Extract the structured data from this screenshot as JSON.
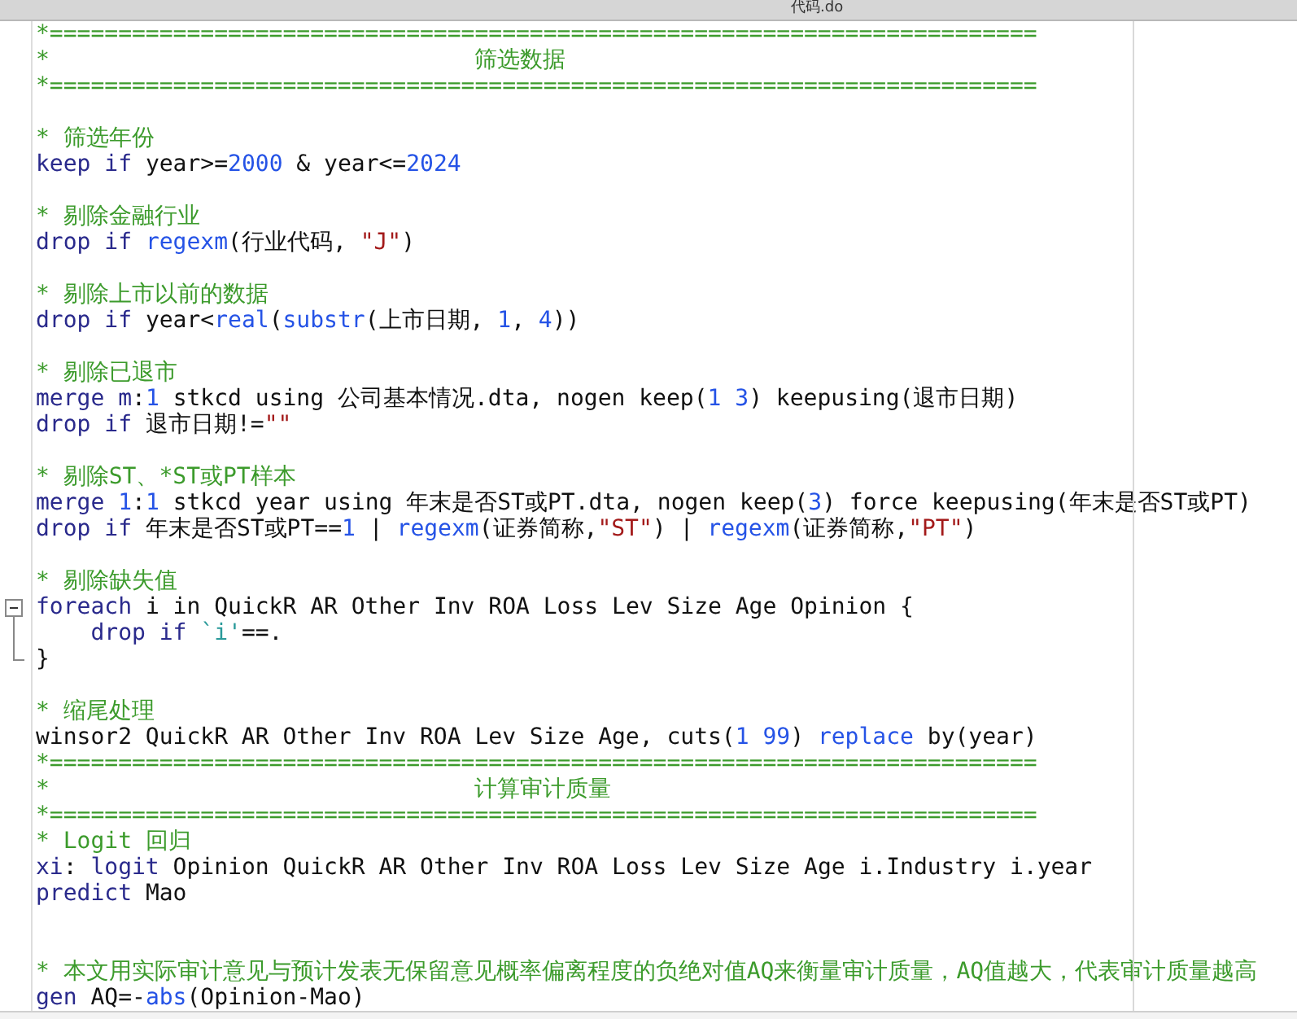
{
  "window": {
    "title": "代码.do"
  },
  "editor": {
    "lines": [
      {
        "kind": "code",
        "tokens": [
          {
            "kind": "comment",
            "text": "*========================================================================"
          }
        ]
      },
      {
        "kind": "code",
        "tokens": [
          {
            "kind": "comment",
            "text": "*                               筛选数据"
          }
        ]
      },
      {
        "kind": "code",
        "tokens": [
          {
            "kind": "comment",
            "text": "*========================================================================"
          }
        ]
      },
      {
        "kind": "blank"
      },
      {
        "kind": "code",
        "tokens": [
          {
            "kind": "comment",
            "text": "* 筛选年份"
          }
        ]
      },
      {
        "kind": "code",
        "tokens": [
          {
            "kind": "keyword",
            "text": "keep if"
          },
          {
            "kind": "plain",
            "text": " year>="
          },
          {
            "kind": "number",
            "text": "2000"
          },
          {
            "kind": "plain",
            "text": " & year<="
          },
          {
            "kind": "number",
            "text": "2024"
          }
        ]
      },
      {
        "kind": "blank"
      },
      {
        "kind": "code",
        "tokens": [
          {
            "kind": "comment",
            "text": "* 剔除金融行业"
          }
        ]
      },
      {
        "kind": "code",
        "tokens": [
          {
            "kind": "keyword",
            "text": "drop if "
          },
          {
            "kind": "function",
            "text": "regexm"
          },
          {
            "kind": "plain",
            "text": "(行业代码, "
          },
          {
            "kind": "string",
            "text": "\"J\""
          },
          {
            "kind": "plain",
            "text": ")"
          }
        ]
      },
      {
        "kind": "blank"
      },
      {
        "kind": "code",
        "tokens": [
          {
            "kind": "comment",
            "text": "* 剔除上市以前的数据"
          }
        ]
      },
      {
        "kind": "code",
        "tokens": [
          {
            "kind": "keyword",
            "text": "drop if"
          },
          {
            "kind": "plain",
            "text": " year<"
          },
          {
            "kind": "function",
            "text": "real"
          },
          {
            "kind": "plain",
            "text": "("
          },
          {
            "kind": "function",
            "text": "substr"
          },
          {
            "kind": "plain",
            "text": "(上市日期, "
          },
          {
            "kind": "number",
            "text": "1"
          },
          {
            "kind": "plain",
            "text": ", "
          },
          {
            "kind": "number",
            "text": "4"
          },
          {
            "kind": "plain",
            "text": "))"
          }
        ]
      },
      {
        "kind": "blank"
      },
      {
        "kind": "code",
        "tokens": [
          {
            "kind": "comment",
            "text": "* 剔除已退市"
          }
        ]
      },
      {
        "kind": "code",
        "tokens": [
          {
            "kind": "keyword",
            "text": "merge m"
          },
          {
            "kind": "plain",
            "text": ":"
          },
          {
            "kind": "number",
            "text": "1"
          },
          {
            "kind": "plain",
            "text": " stkcd using 公司基本情况.dta, nogen keep("
          },
          {
            "kind": "number",
            "text": "1 3"
          },
          {
            "kind": "plain",
            "text": ") keepusing(退市日期)"
          }
        ]
      },
      {
        "kind": "code",
        "tokens": [
          {
            "kind": "keyword",
            "text": "drop if"
          },
          {
            "kind": "plain",
            "text": " 退市日期!="
          },
          {
            "kind": "string",
            "text": "\"\""
          }
        ]
      },
      {
        "kind": "blank"
      },
      {
        "kind": "code",
        "tokens": [
          {
            "kind": "comment",
            "text": "* 剔除ST、*ST或PT样本"
          }
        ]
      },
      {
        "kind": "code",
        "tokens": [
          {
            "kind": "keyword",
            "text": "merge "
          },
          {
            "kind": "number",
            "text": "1"
          },
          {
            "kind": "plain",
            "text": ":"
          },
          {
            "kind": "number",
            "text": "1"
          },
          {
            "kind": "plain",
            "text": " stkcd year using 年末是否ST或PT.dta, nogen keep("
          },
          {
            "kind": "number",
            "text": "3"
          },
          {
            "kind": "plain",
            "text": ") force keepusing(年末是否ST或PT)"
          }
        ]
      },
      {
        "kind": "code",
        "tokens": [
          {
            "kind": "keyword",
            "text": "drop if"
          },
          {
            "kind": "plain",
            "text": " 年末是否ST或PT=="
          },
          {
            "kind": "number",
            "text": "1"
          },
          {
            "kind": "plain",
            "text": " | "
          },
          {
            "kind": "function",
            "text": "regexm"
          },
          {
            "kind": "plain",
            "text": "(证券简称,"
          },
          {
            "kind": "string",
            "text": "\"ST\""
          },
          {
            "kind": "plain",
            "text": ") | "
          },
          {
            "kind": "function",
            "text": "regexm"
          },
          {
            "kind": "plain",
            "text": "(证券简称,"
          },
          {
            "kind": "string",
            "text": "\"PT\""
          },
          {
            "kind": "plain",
            "text": ")"
          }
        ]
      },
      {
        "kind": "blank"
      },
      {
        "kind": "code",
        "tokens": [
          {
            "kind": "comment",
            "text": "* 剔除缺失值"
          }
        ]
      },
      {
        "kind": "fold_start",
        "tokens": [
          {
            "kind": "keyword",
            "text": "foreach"
          },
          {
            "kind": "plain",
            "text": " i in QuickR AR Other Inv ROA Loss Lev Size Age Opinion {"
          }
        ]
      },
      {
        "kind": "fold_body",
        "tokens": [
          {
            "kind": "keyword",
            "text": "    drop if "
          },
          {
            "kind": "macro",
            "text": "`i'"
          },
          {
            "kind": "plain",
            "text": "==."
          }
        ]
      },
      {
        "kind": "fold_end",
        "tokens": [
          {
            "kind": "plain",
            "text": "}"
          }
        ]
      },
      {
        "kind": "blank"
      },
      {
        "kind": "code",
        "tokens": [
          {
            "kind": "comment",
            "text": "* 缩尾处理"
          }
        ]
      },
      {
        "kind": "code",
        "tokens": [
          {
            "kind": "plain",
            "text": "winsor2 QuickR AR Other Inv ROA Lev Size Age, cuts("
          },
          {
            "kind": "number",
            "text": "1 99"
          },
          {
            "kind": "plain",
            "text": ") "
          },
          {
            "kind": "function",
            "text": "replace"
          },
          {
            "kind": "plain",
            "text": " by(year)"
          }
        ]
      },
      {
        "kind": "code",
        "tokens": [
          {
            "kind": "comment",
            "text": "*========================================================================"
          }
        ]
      },
      {
        "kind": "code",
        "tokens": [
          {
            "kind": "comment",
            "text": "*                               计算审计质量"
          }
        ]
      },
      {
        "kind": "code",
        "tokens": [
          {
            "kind": "comment",
            "text": "*========================================================================"
          }
        ]
      },
      {
        "kind": "code",
        "tokens": [
          {
            "kind": "comment",
            "text": "* Logit 回归"
          }
        ]
      },
      {
        "kind": "code",
        "tokens": [
          {
            "kind": "keyword",
            "text": "xi"
          },
          {
            "kind": "plain",
            "text": ": "
          },
          {
            "kind": "keyword",
            "text": "logit"
          },
          {
            "kind": "plain",
            "text": " Opinion QuickR AR Other Inv ROA Loss Lev Size Age i.Industry i.year"
          }
        ]
      },
      {
        "kind": "code",
        "tokens": [
          {
            "kind": "keyword",
            "text": "predict"
          },
          {
            "kind": "plain",
            "text": " Mao"
          }
        ]
      },
      {
        "kind": "blank"
      },
      {
        "kind": "blank"
      },
      {
        "kind": "code",
        "tokens": [
          {
            "kind": "comment",
            "text": "* 本文用实际审计意见与预计发表无保留意见概率偏离程度的负绝对值AQ来衡量审计质量，AQ值越大，代表审计质量越高"
          }
        ]
      },
      {
        "kind": "code",
        "tokens": [
          {
            "kind": "keyword",
            "text": "gen"
          },
          {
            "kind": "plain",
            "text": " AQ=-"
          },
          {
            "kind": "function",
            "text": "abs"
          },
          {
            "kind": "plain",
            "text": "(Opinion-Mao)"
          }
        ]
      }
    ]
  }
}
